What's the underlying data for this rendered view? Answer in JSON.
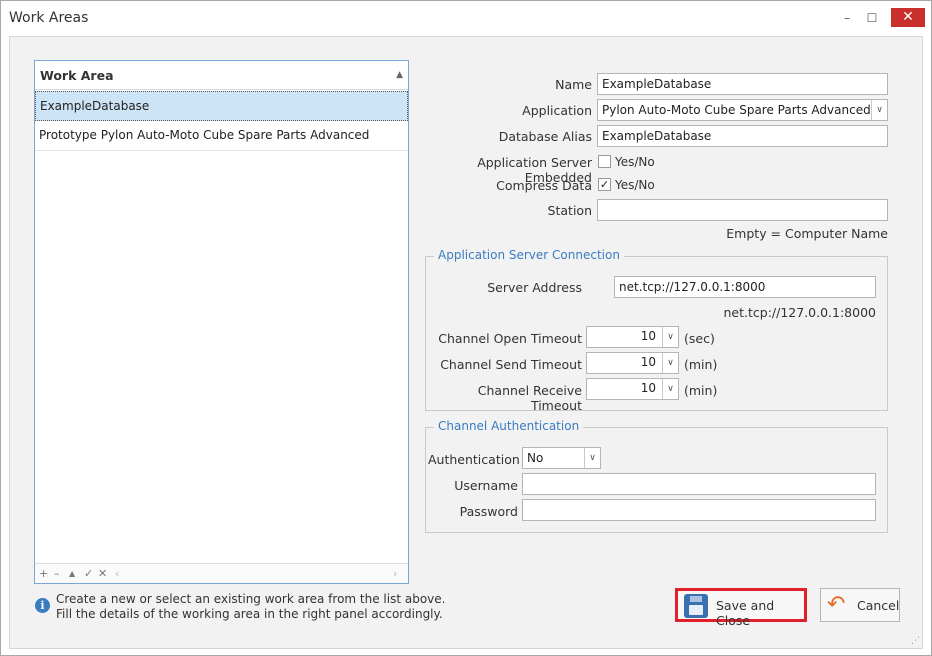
{
  "window": {
    "title": "Work Areas",
    "controls": {
      "minimize": "–",
      "maximize": "☐",
      "close": "✕"
    }
  },
  "list": {
    "header": "Work Area",
    "sort_indicator": "▲",
    "items": [
      {
        "label": "ExampleDatabase",
        "selected": true
      },
      {
        "label": "Prototype Pylon Auto-Moto Cube Spare Parts Advanced",
        "selected": false
      }
    ],
    "footer_icons": [
      "+",
      "–",
      "▲",
      "✓",
      "✕",
      "‹",
      "›"
    ]
  },
  "info": {
    "icon": "info-icon",
    "line1": "Create a new or select an existing work area from the list above.",
    "line2": "Fill the details of the working area in the right panel accordingly."
  },
  "form": {
    "name": {
      "label": "Name",
      "value": "ExampleDatabase"
    },
    "application": {
      "label": "Application",
      "value": "Pylon Auto-Moto Cube Spare Parts Advanced"
    },
    "database_alias": {
      "label": "Database Alias",
      "value": "ExampleDatabase"
    },
    "app_server_embedded": {
      "label": "Application Server Embedded",
      "checked": false,
      "text": "Yes/No"
    },
    "compress_data": {
      "label": "Compress Data",
      "checked": true,
      "check_mark": "✓",
      "text": "Yes/No"
    },
    "station": {
      "label": "Station",
      "value": "",
      "hint": "Empty = Computer Name"
    }
  },
  "app_server_connection": {
    "title": "Application Server Connection",
    "server_address": {
      "label": "Server Address",
      "value": "net.tcp://127.0.0.1:8000",
      "hint": "net.tcp://127.0.0.1:8000"
    },
    "open_timeout": {
      "label": "Channel Open Timeout",
      "value": "10",
      "unit": "(sec)"
    },
    "send_timeout": {
      "label": "Channel Send Timeout",
      "value": "10",
      "unit": "(min)"
    },
    "receive_timeout": {
      "label": "Channel Receive Timeout",
      "value": "10",
      "unit": "(min)"
    }
  },
  "channel_auth": {
    "title": "Channel Authentication",
    "authentication": {
      "label": "Authentication",
      "value": "No"
    },
    "username": {
      "label": "Username",
      "value": ""
    },
    "password": {
      "label": "Password",
      "value": ""
    }
  },
  "buttons": {
    "save": "Save and Close",
    "cancel": "Cancel"
  },
  "colors": {
    "accent": "#3a7cc0",
    "highlight_border": "#e0212b",
    "selected_row": "#cde4f7",
    "close_button": "#c9302c"
  }
}
